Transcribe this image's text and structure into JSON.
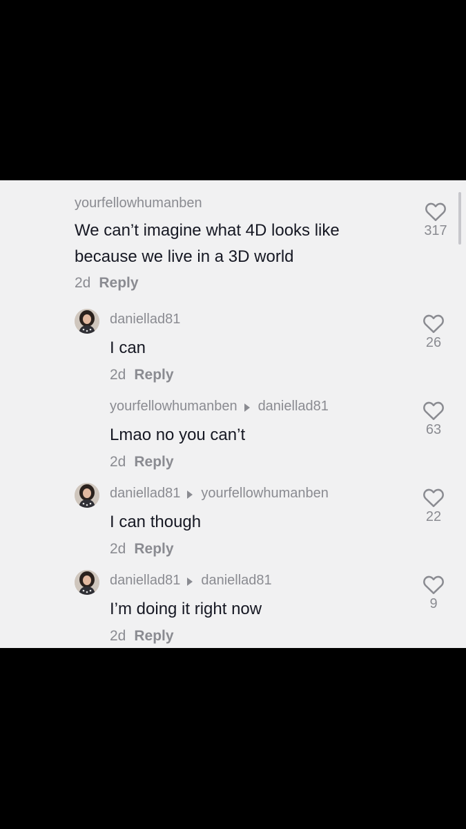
{
  "comments": [
    {
      "user": "yourfellowhumanben",
      "reply_to": "",
      "text_lines": [
        "We can’t imagine what 4D looks like",
        "because we live in a 3D world"
      ],
      "time": "2d",
      "reply_label": "Reply",
      "likes": "317",
      "has_avatar": false
    },
    {
      "user": "daniellad81",
      "reply_to": "",
      "text_lines": [
        "I can"
      ],
      "time": "2d",
      "reply_label": "Reply",
      "likes": "26",
      "has_avatar": true
    },
    {
      "user": "yourfellowhumanben",
      "reply_to": "daniellad81",
      "text_lines": [
        "Lmao no you can’t"
      ],
      "time": "2d",
      "reply_label": "Reply",
      "likes": "63",
      "has_avatar": false
    },
    {
      "user": "daniellad81",
      "reply_to": "yourfellowhumanben",
      "text_lines": [
        "I can though"
      ],
      "time": "2d",
      "reply_label": "Reply",
      "likes": "22",
      "has_avatar": true
    },
    {
      "user": "daniellad81",
      "reply_to": "daniellad81",
      "text_lines": [
        "I’m doing it right now"
      ],
      "time": "2d",
      "reply_label": "Reply",
      "likes": "9",
      "has_avatar": true
    }
  ],
  "colors": {
    "panel_bg": "#f1f1f2",
    "frame_bg": "#000000",
    "secondary_text": "#8a8b91",
    "primary_text": "#161823"
  },
  "icons": {
    "like": "heart-outline-icon",
    "reply_arrow": "caret-right-icon"
  }
}
